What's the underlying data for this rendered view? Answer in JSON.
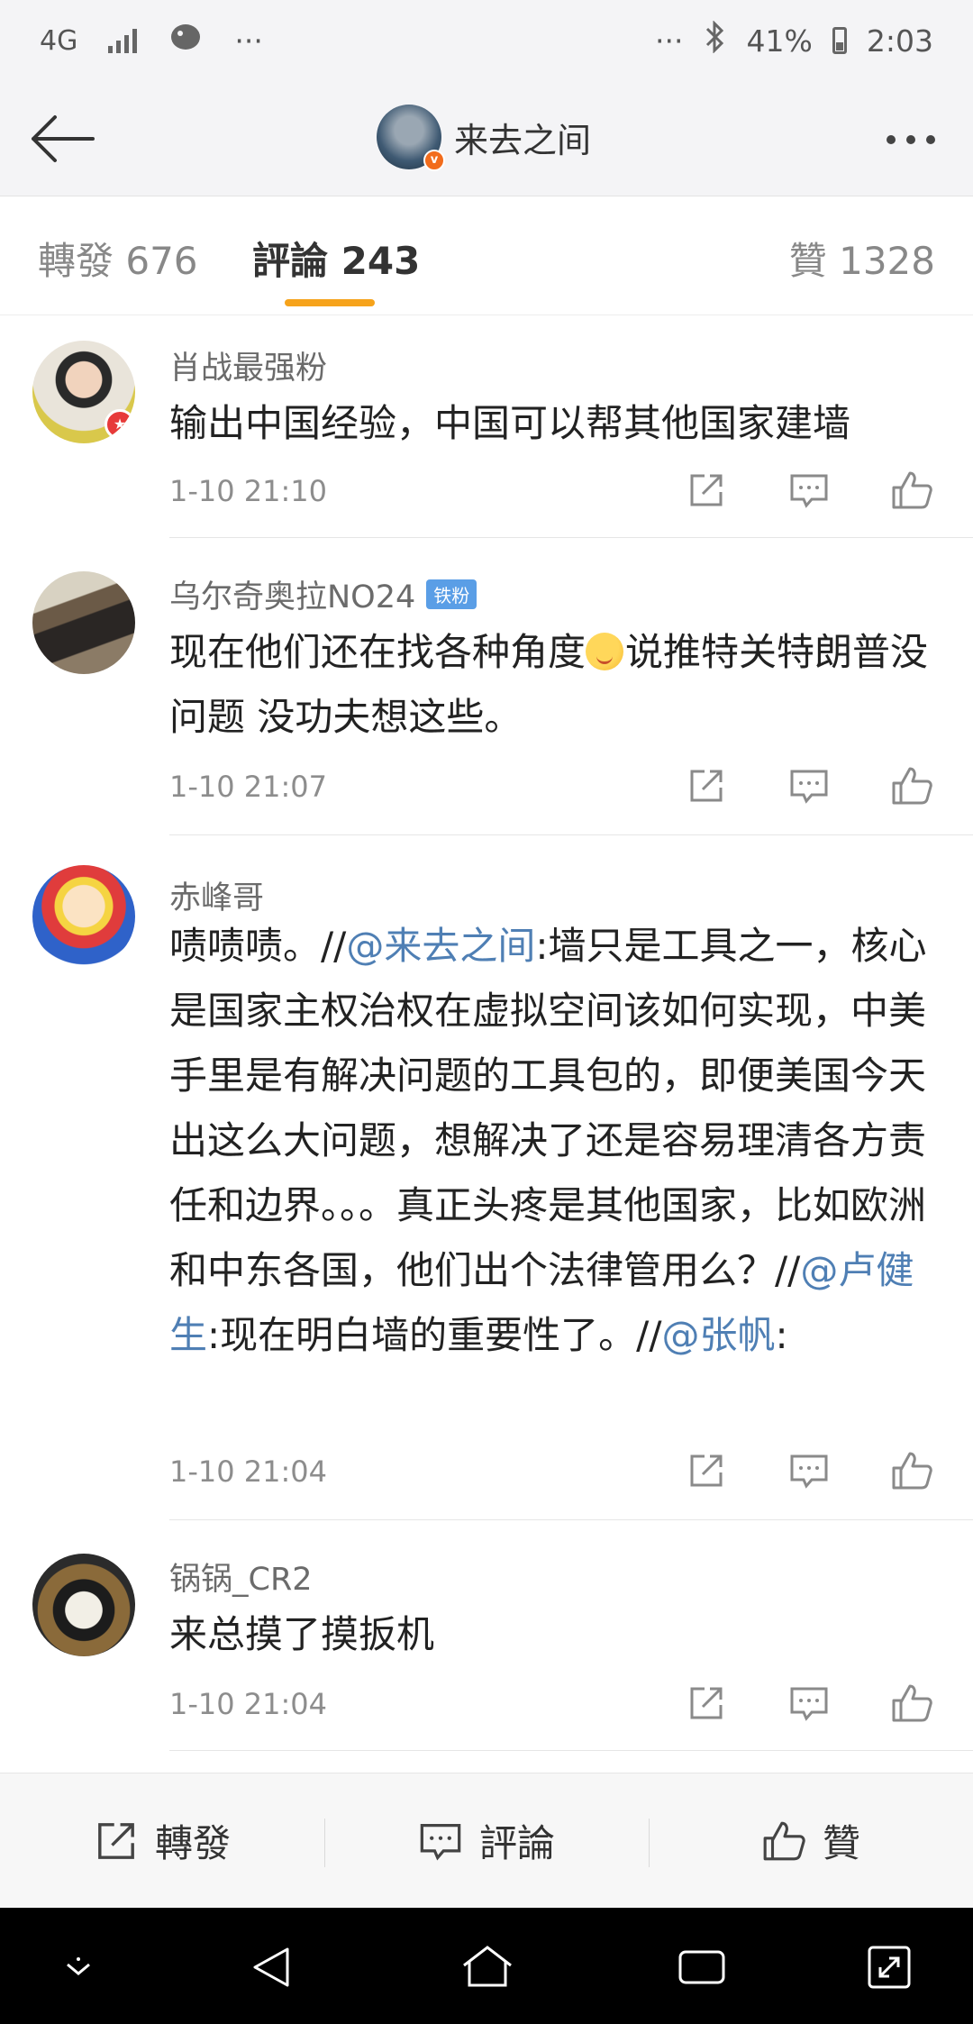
{
  "status_bar": {
    "network": "4G",
    "left_more": "···",
    "right_more": "···",
    "battery": "41%",
    "time": "2:03"
  },
  "nav": {
    "title": "来去之间",
    "verified_mark": "v"
  },
  "tabs": {
    "repost": "轉發 676",
    "comments": "評論 243",
    "likes": "贊 1328"
  },
  "comments": [
    {
      "name": "肖战最强粉",
      "text": "输出中国经验，中国可以帮其他国家建墙",
      "time": "1-10 21:10"
    },
    {
      "name": "乌尔奇奥拉NO24",
      "badge": "铁粉",
      "text_before_emoji": "现在他们还在找各种角度",
      "text_after_emoji": "说推特关特朗普没问题 没功夫想这些。",
      "time": "1-10 21:07"
    },
    {
      "name": "赤峰哥",
      "text_part1": "啧啧啧。//",
      "mention1": "@来去之间",
      "text_part2": ":墙只是工具之一，核心是国家主权治权在虚拟空间该如何实现，中美手里是有解决问题的工具包的，即便美国今天出这么大问题，想解决了还是容易理清各方责任和边界。。。真正头疼是其他国家，比如欧洲和中东各国，他们出个法律管用么？//",
      "mention2": "@卢健生",
      "text_part3": ":现在明白墙的重要性了。//",
      "mention3": "@张帆",
      "text_part4": ":",
      "time": "1-10 21:04"
    },
    {
      "name": "锅锅_CR2",
      "text": "来总摸了摸扳机",
      "time": "1-10 21:04"
    }
  ],
  "bottom_bar": {
    "repost": "轉發",
    "comment": "評論",
    "like": "贊"
  }
}
